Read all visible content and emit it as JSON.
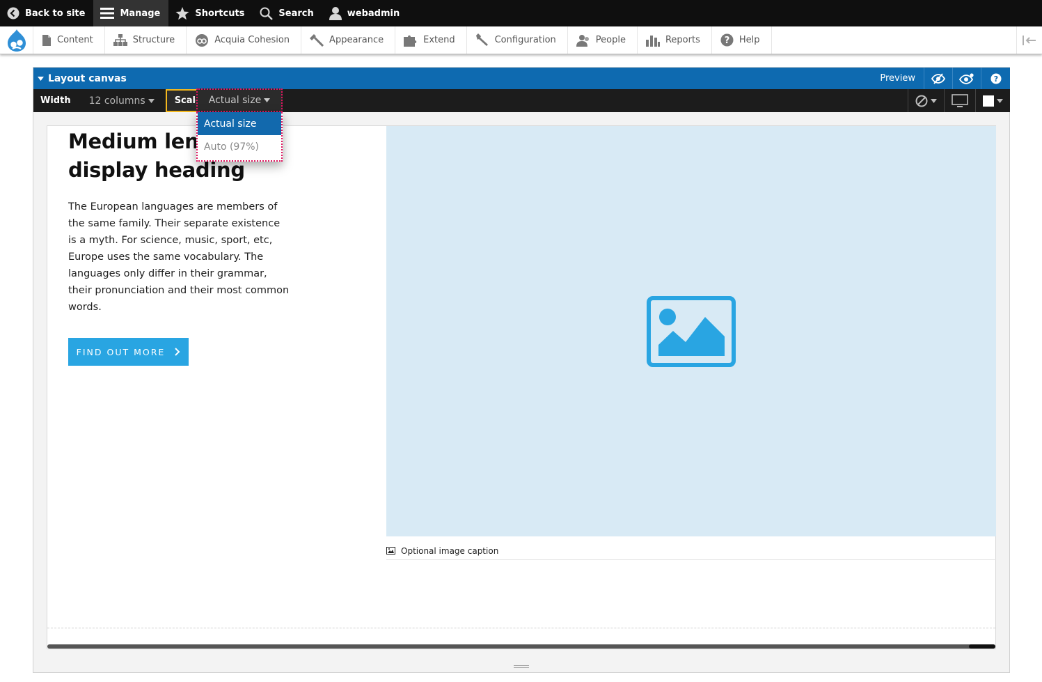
{
  "topbar": {
    "back_to_site": "Back to site",
    "manage": "Manage",
    "shortcuts": "Shortcuts",
    "search": "Search",
    "user": "webadmin"
  },
  "menu": {
    "items": [
      {
        "label": "Content",
        "icon": "page-icon"
      },
      {
        "label": "Structure",
        "icon": "structure-icon"
      },
      {
        "label": "Acquia Cohesion",
        "icon": "cohesion-icon"
      },
      {
        "label": "Appearance",
        "icon": "brush-icon"
      },
      {
        "label": "Extend",
        "icon": "puzzle-icon"
      },
      {
        "label": "Configuration",
        "icon": "wrench-icon"
      },
      {
        "label": "People",
        "icon": "people-icon"
      },
      {
        "label": "Reports",
        "icon": "bar-chart-icon"
      },
      {
        "label": "Help",
        "icon": "help-icon"
      }
    ]
  },
  "canvas": {
    "title": "Layout canvas",
    "preview": "Preview",
    "width_label": "Width",
    "width_value": "12 columns",
    "scale_label": "Scale",
    "scale_value": "Actual size",
    "scale_options": [
      "Actual size",
      "Auto (97%)"
    ]
  },
  "content": {
    "heading": "Medium length display heading",
    "body": "The European languages are members of the same family. Their separate existence is a myth. For science, music, sport, etc, Europe uses the same vocabulary. The languages only differ in their grammar, their pronunciation and their most common words.",
    "cta": "FIND OUT MORE",
    "caption": "Optional image caption"
  },
  "colors": {
    "accent_blue": "#0e6ab0",
    "cta_blue": "#29a5e2",
    "highlight_pink": "#e0155f",
    "scale_outline": "#f4b81e",
    "image_placeholder": "#d8eaf5"
  }
}
